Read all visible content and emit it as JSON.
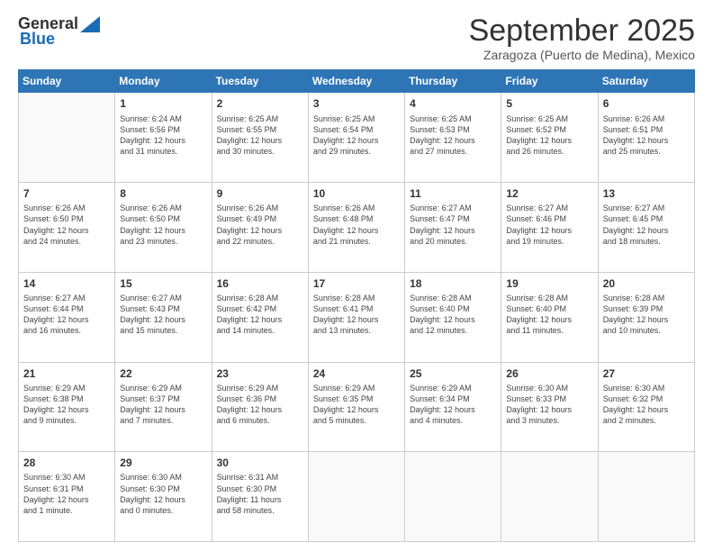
{
  "logo": {
    "line1": "General",
    "line2": "Blue"
  },
  "header": {
    "title": "September 2025",
    "subtitle": "Zaragoza (Puerto de Medina), Mexico"
  },
  "weekdays": [
    "Sunday",
    "Monday",
    "Tuesday",
    "Wednesday",
    "Thursday",
    "Friday",
    "Saturday"
  ],
  "weeks": [
    [
      {
        "day": "",
        "info": ""
      },
      {
        "day": "1",
        "info": "Sunrise: 6:24 AM\nSunset: 6:56 PM\nDaylight: 12 hours\nand 31 minutes."
      },
      {
        "day": "2",
        "info": "Sunrise: 6:25 AM\nSunset: 6:55 PM\nDaylight: 12 hours\nand 30 minutes."
      },
      {
        "day": "3",
        "info": "Sunrise: 6:25 AM\nSunset: 6:54 PM\nDaylight: 12 hours\nand 29 minutes."
      },
      {
        "day": "4",
        "info": "Sunrise: 6:25 AM\nSunset: 6:53 PM\nDaylight: 12 hours\nand 27 minutes."
      },
      {
        "day": "5",
        "info": "Sunrise: 6:25 AM\nSunset: 6:52 PM\nDaylight: 12 hours\nand 26 minutes."
      },
      {
        "day": "6",
        "info": "Sunrise: 6:26 AM\nSunset: 6:51 PM\nDaylight: 12 hours\nand 25 minutes."
      }
    ],
    [
      {
        "day": "7",
        "info": "Sunrise: 6:26 AM\nSunset: 6:50 PM\nDaylight: 12 hours\nand 24 minutes."
      },
      {
        "day": "8",
        "info": "Sunrise: 6:26 AM\nSunset: 6:50 PM\nDaylight: 12 hours\nand 23 minutes."
      },
      {
        "day": "9",
        "info": "Sunrise: 6:26 AM\nSunset: 6:49 PM\nDaylight: 12 hours\nand 22 minutes."
      },
      {
        "day": "10",
        "info": "Sunrise: 6:26 AM\nSunset: 6:48 PM\nDaylight: 12 hours\nand 21 minutes."
      },
      {
        "day": "11",
        "info": "Sunrise: 6:27 AM\nSunset: 6:47 PM\nDaylight: 12 hours\nand 20 minutes."
      },
      {
        "day": "12",
        "info": "Sunrise: 6:27 AM\nSunset: 6:46 PM\nDaylight: 12 hours\nand 19 minutes."
      },
      {
        "day": "13",
        "info": "Sunrise: 6:27 AM\nSunset: 6:45 PM\nDaylight: 12 hours\nand 18 minutes."
      }
    ],
    [
      {
        "day": "14",
        "info": "Sunrise: 6:27 AM\nSunset: 6:44 PM\nDaylight: 12 hours\nand 16 minutes."
      },
      {
        "day": "15",
        "info": "Sunrise: 6:27 AM\nSunset: 6:43 PM\nDaylight: 12 hours\nand 15 minutes."
      },
      {
        "day": "16",
        "info": "Sunrise: 6:28 AM\nSunset: 6:42 PM\nDaylight: 12 hours\nand 14 minutes."
      },
      {
        "day": "17",
        "info": "Sunrise: 6:28 AM\nSunset: 6:41 PM\nDaylight: 12 hours\nand 13 minutes."
      },
      {
        "day": "18",
        "info": "Sunrise: 6:28 AM\nSunset: 6:40 PM\nDaylight: 12 hours\nand 12 minutes."
      },
      {
        "day": "19",
        "info": "Sunrise: 6:28 AM\nSunset: 6:40 PM\nDaylight: 12 hours\nand 11 minutes."
      },
      {
        "day": "20",
        "info": "Sunrise: 6:28 AM\nSunset: 6:39 PM\nDaylight: 12 hours\nand 10 minutes."
      }
    ],
    [
      {
        "day": "21",
        "info": "Sunrise: 6:29 AM\nSunset: 6:38 PM\nDaylight: 12 hours\nand 9 minutes."
      },
      {
        "day": "22",
        "info": "Sunrise: 6:29 AM\nSunset: 6:37 PM\nDaylight: 12 hours\nand 7 minutes."
      },
      {
        "day": "23",
        "info": "Sunrise: 6:29 AM\nSunset: 6:36 PM\nDaylight: 12 hours\nand 6 minutes."
      },
      {
        "day": "24",
        "info": "Sunrise: 6:29 AM\nSunset: 6:35 PM\nDaylight: 12 hours\nand 5 minutes."
      },
      {
        "day": "25",
        "info": "Sunrise: 6:29 AM\nSunset: 6:34 PM\nDaylight: 12 hours\nand 4 minutes."
      },
      {
        "day": "26",
        "info": "Sunrise: 6:30 AM\nSunset: 6:33 PM\nDaylight: 12 hours\nand 3 minutes."
      },
      {
        "day": "27",
        "info": "Sunrise: 6:30 AM\nSunset: 6:32 PM\nDaylight: 12 hours\nand 2 minutes."
      }
    ],
    [
      {
        "day": "28",
        "info": "Sunrise: 6:30 AM\nSunset: 6:31 PM\nDaylight: 12 hours\nand 1 minute."
      },
      {
        "day": "29",
        "info": "Sunrise: 6:30 AM\nSunset: 6:30 PM\nDaylight: 12 hours\nand 0 minutes."
      },
      {
        "day": "30",
        "info": "Sunrise: 6:31 AM\nSunset: 6:30 PM\nDaylight: 11 hours\nand 58 minutes."
      },
      {
        "day": "",
        "info": ""
      },
      {
        "day": "",
        "info": ""
      },
      {
        "day": "",
        "info": ""
      },
      {
        "day": "",
        "info": ""
      }
    ]
  ]
}
